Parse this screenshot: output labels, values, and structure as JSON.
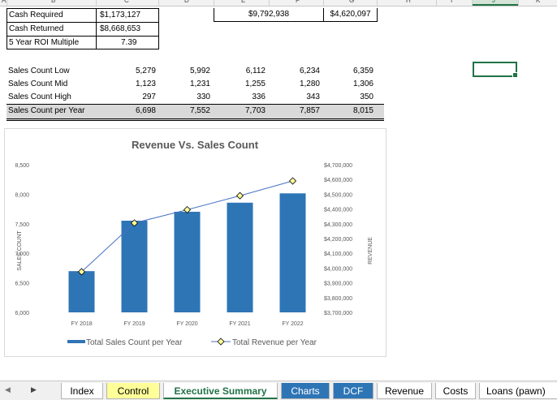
{
  "column_headers": [
    "A",
    "B",
    "C",
    "D",
    "E",
    "F",
    "G",
    "H",
    "I",
    "J",
    "K"
  ],
  "top_block": {
    "rows": [
      {
        "label": "Cash Required",
        "value": "$1,173,127"
      },
      {
        "label": "Cash Returned",
        "value": "$8,668,653"
      },
      {
        "label": "5 Year ROI Multiple",
        "value": "7.39"
      }
    ],
    "e_value": "$9,792,938",
    "g_value": "$4,620,097"
  },
  "sales_table": {
    "rows": [
      {
        "label": "Sales Count Low",
        "values": [
          "5,279",
          "5,992",
          "6,112",
          "6,234",
          "6,359"
        ]
      },
      {
        "label": "Sales Count Mid",
        "values": [
          "1,123",
          "1,231",
          "1,255",
          "1,280",
          "1,306"
        ]
      },
      {
        "label": "Sales Count High",
        "values": [
          "297",
          "330",
          "336",
          "343",
          "350"
        ]
      },
      {
        "label": "Sales Count per Year",
        "values": [
          "6,698",
          "7,552",
          "7,703",
          "7,857",
          "8,015"
        ]
      }
    ]
  },
  "chart_data": {
    "type": "bar",
    "title": "Revenue Vs. Sales Count",
    "ylabel": "SALES COUNT",
    "y2label": "REVENUE",
    "categories": [
      "FY 2018",
      "FY 2019",
      "FY 2020",
      "FY 2021",
      "FY 2022"
    ],
    "ylim": [
      6000,
      8500
    ],
    "yticks": [
      "8,500",
      "8,000",
      "7,500",
      "7,000",
      "6,500",
      "6,000"
    ],
    "y2lim": [
      3700000,
      4700000
    ],
    "y2ticks": [
      "$4,700,000",
      "$4,600,000",
      "$4,500,000",
      "$4,400,000",
      "$4,300,000",
      "$4,200,000",
      "$4,100,000",
      "$4,000,000",
      "$3,900,000",
      "$3,800,000",
      "$3,700,000"
    ],
    "series": [
      {
        "name": "Total Sales Count per Year",
        "type": "bar",
        "axis": "left",
        "values": [
          6698,
          7552,
          7703,
          7857,
          8015
        ],
        "color": "#2e75b6"
      },
      {
        "name": "Total Revenue per Year",
        "type": "line",
        "axis": "right",
        "values": [
          3975000,
          4305000,
          4395000,
          4490000,
          4590000
        ],
        "color": "#4472c4",
        "marker_fill": "#ffff99"
      }
    ],
    "legend_position": "bottom"
  },
  "tabs": [
    {
      "label": "Index",
      "bg": "#ffffff",
      "color": "#000000"
    },
    {
      "label": "Control",
      "bg": "#ffff99",
      "color": "#000000"
    },
    {
      "label": "Executive Summary",
      "bg": "#ffffff",
      "color": "#217346",
      "active": true
    },
    {
      "label": "Charts",
      "bg": "#2e75b6",
      "color": "#ffffff"
    },
    {
      "label": "DCF",
      "bg": "#2e75b6",
      "color": "#ffffff"
    },
    {
      "label": "Revenue",
      "bg": "#ffffff",
      "color": "#000000"
    },
    {
      "label": "Costs",
      "bg": "#ffffff",
      "color": "#000000"
    },
    {
      "label": "Loans (pawn)",
      "bg": "#ffffff",
      "color": "#000000"
    }
  ],
  "nav": {
    "prev": "◀",
    "next": "▶"
  }
}
